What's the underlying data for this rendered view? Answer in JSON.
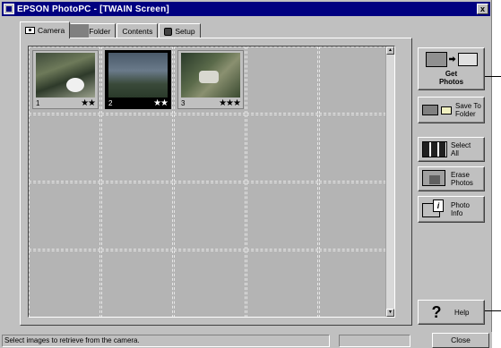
{
  "window": {
    "title": "EPSON PhotoPC - [TWAIN Screen]",
    "close_glyph": "x"
  },
  "tabs": [
    {
      "label": "Camera",
      "icon": "camera-icon",
      "active": true
    },
    {
      "label": "Folder",
      "icon": "folder-icon",
      "active": false
    },
    {
      "label": "Contents",
      "icon": "thumbnails-icon",
      "active": false
    },
    {
      "label": "Setup",
      "icon": "settings-icon",
      "active": false
    }
  ],
  "photos": [
    {
      "number": "1",
      "stars": "★★",
      "selected": false
    },
    {
      "number": "2",
      "stars": "★★",
      "selected": true
    },
    {
      "number": "3",
      "stars": "★★★",
      "selected": false
    }
  ],
  "side_buttons": {
    "get_photos": "Get\nPhotos",
    "save_to_folder": "Save To\nFolder",
    "select_all": "Select\nAll",
    "erase_photos": "Erase\nPhotos",
    "photo_info": "Photo\nInfo",
    "help": "Help"
  },
  "statusbar": {
    "message": "Select images to retrieve from the camera.",
    "progress": 0,
    "close_label": "Close"
  },
  "colors": {
    "titlebar": "#000080",
    "face": "#c0c0c0",
    "grid_bg": "#b4b4b4"
  }
}
